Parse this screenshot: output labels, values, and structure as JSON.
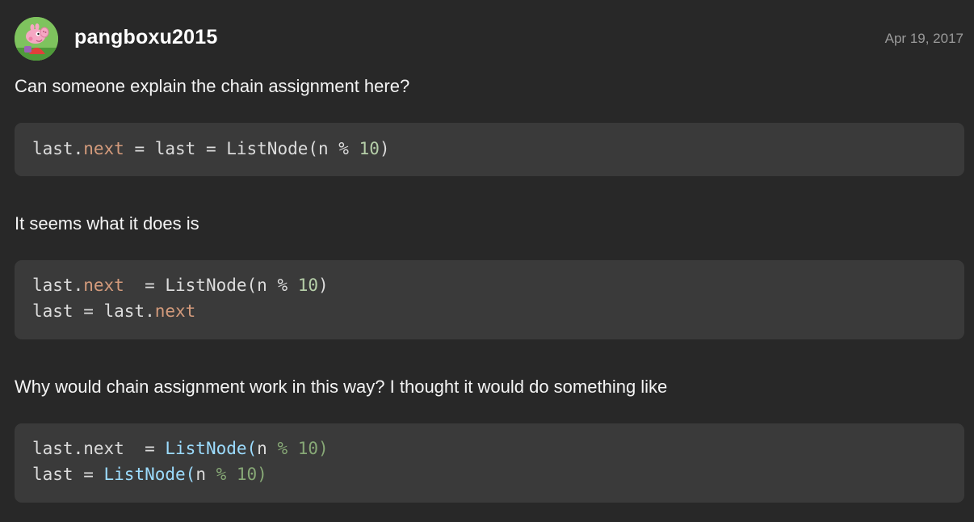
{
  "post": {
    "author": "pangboxu2015",
    "date": "Apr 19, 2017",
    "avatar_icon": "peppa-pig-avatar-icon"
  },
  "paragraphs": [
    "Can someone explain the chain assignment here?",
    "It seems what it does is",
    "Why would chain assignment work in this way? I thought it would do something like"
  ],
  "code_blocks": [
    {
      "lines": [
        "last.next = last = ListNode(n % 10)"
      ],
      "tokens": [
        [
          {
            "t": "last.",
            "c": "plain"
          },
          {
            "t": "next",
            "c": "prop"
          },
          {
            "t": " = last = ListNode(n % ",
            "c": "plain"
          },
          {
            "t": "10",
            "c": "num"
          },
          {
            "t": ")",
            "c": "plain"
          }
        ]
      ]
    },
    {
      "lines": [
        "last.next  = ListNode(n % 10)",
        "last = last.next"
      ],
      "tokens": [
        [
          {
            "t": "last.",
            "c": "plain"
          },
          {
            "t": "next",
            "c": "prop"
          },
          {
            "t": "  = ListNode(n % ",
            "c": "plain"
          },
          {
            "t": "10",
            "c": "num"
          },
          {
            "t": ")",
            "c": "plain"
          }
        ],
        [
          {
            "t": "last = last.",
            "c": "plain"
          },
          {
            "t": "next",
            "c": "prop"
          }
        ]
      ]
    },
    {
      "lines": [
        "last.next  = ListNode(n % 10)",
        "last = ListNode(n % 10)"
      ],
      "tokens": [
        [
          {
            "t": "last.next  = ",
            "c": "plain"
          },
          {
            "t": "ListNode(",
            "c": "fn"
          },
          {
            "t": "n ",
            "c": "plain"
          },
          {
            "t": "% 10)",
            "c": "numg"
          }
        ],
        [
          {
            "t": "last = ",
            "c": "plain"
          },
          {
            "t": "ListNode(",
            "c": "fn"
          },
          {
            "t": "n ",
            "c": "plain"
          },
          {
            "t": "% 10)",
            "c": "numg"
          }
        ]
      ]
    }
  ],
  "colors": {
    "background": "#282828",
    "code_background": "#3a3a3a",
    "property": "#d49b7c",
    "number": "#b5cea8",
    "function": "#9cdcfe"
  }
}
